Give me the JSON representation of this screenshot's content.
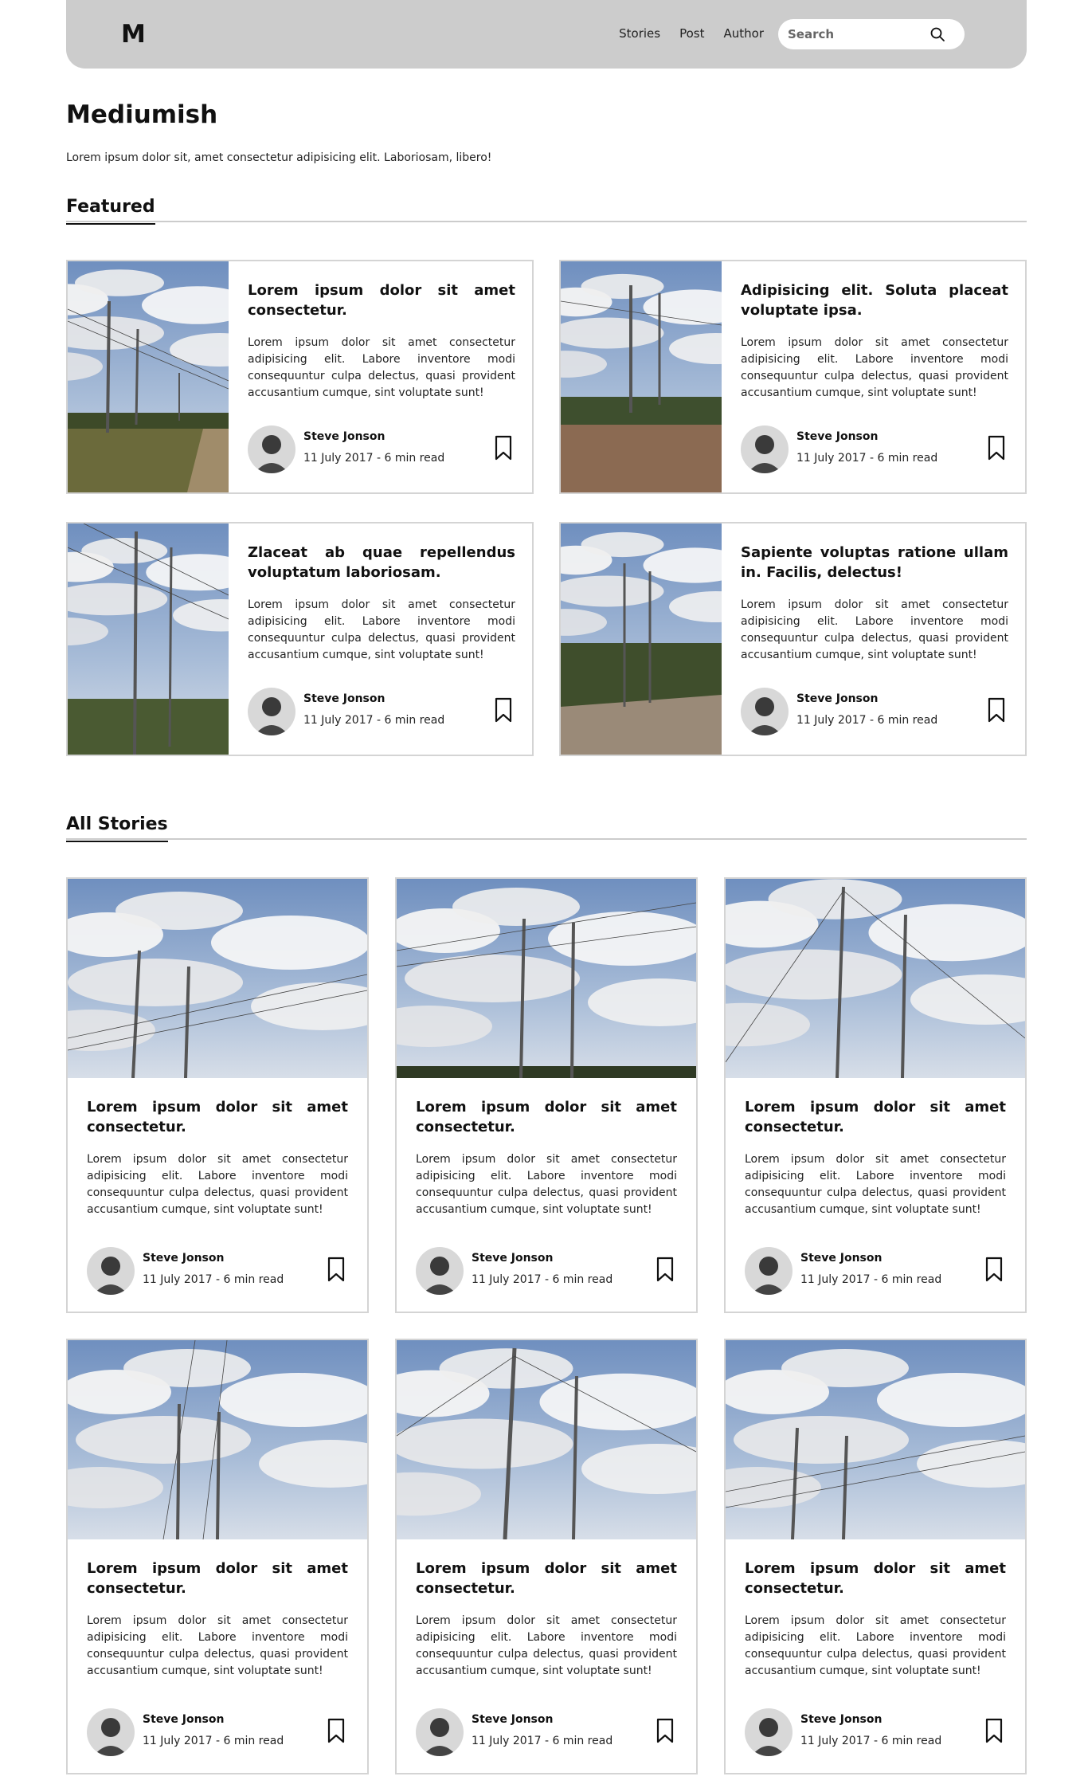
{
  "header": {
    "logo": "M",
    "nav": [
      "Stories",
      "Post",
      "Author"
    ],
    "search_placeholder": "Search"
  },
  "intro": {
    "title": "Mediumish",
    "description": "Lorem ipsum dolor sit, amet consectetur adipisicing elit. Laboriosam, libero!"
  },
  "featured": {
    "heading": "Featured",
    "cards": [
      {
        "title": "Lorem ipsum dolor sit amet consectetur.",
        "excerpt": "Lorem ipsum dolor sit amet consectetur adipisicing elit. Labore inventore modi consequuntur culpa delectus, quasi provident accusantium cumque, sint voluptate sunt!",
        "author": "Steve Jonson",
        "meta": "11 July 2017 - 6 min read"
      },
      {
        "title": "Adipisicing elit. Soluta placeat voluptate ipsa.",
        "excerpt": "Lorem ipsum dolor sit amet consectetur adipisicing elit. Labore inventore modi consequuntur culpa delectus, quasi provident accusantium cumque, sint voluptate sunt!",
        "author": "Steve Jonson",
        "meta": "11 July 2017 - 6 min read"
      },
      {
        "title": "Zlaceat ab quae repellendus voluptatum laboriosam.",
        "excerpt": "Lorem ipsum dolor sit amet consectetur adipisicing elit. Labore inventore modi consequuntur culpa delectus, quasi provident accusantium cumque, sint voluptate sunt!",
        "author": "Steve Jonson",
        "meta": "11 July 2017 - 6 min read"
      },
      {
        "title": "Sapiente voluptas ratione ullam in. Facilis, delectus!",
        "excerpt": "Lorem ipsum dolor sit amet consectetur adipisicing elit. Labore inventore modi consequuntur culpa delectus, quasi provident accusantium cumque, sint voluptate sunt!",
        "author": "Steve Jonson",
        "meta": "11 July 2017 - 6 min read"
      }
    ]
  },
  "stories": {
    "heading": "All Stories",
    "cards": [
      {
        "title": "Lorem ipsum dolor sit amet consectetur.",
        "excerpt": "Lorem ipsum dolor sit amet consectetur adipisicing elit. Labore inventore modi consequuntur culpa delectus, quasi provident accusantium cumque, sint voluptate sunt!",
        "author": "Steve Jonson",
        "meta": "11 July 2017 - 6 min read"
      },
      {
        "title": "Lorem ipsum dolor sit amet consectetur.",
        "excerpt": "Lorem ipsum dolor sit amet consectetur adipisicing elit. Labore inventore modi consequuntur culpa delectus, quasi provident accusantium cumque, sint voluptate sunt!",
        "author": "Steve Jonson",
        "meta": "11 July 2017 - 6 min read"
      },
      {
        "title": "Lorem ipsum dolor sit amet consectetur.",
        "excerpt": "Lorem ipsum dolor sit amet consectetur adipisicing elit. Labore inventore modi consequuntur culpa delectus, quasi provident accusantium cumque, sint voluptate sunt!",
        "author": "Steve Jonson",
        "meta": "11 July 2017 - 6 min read"
      },
      {
        "title": "Lorem ipsum dolor sit amet consectetur.",
        "excerpt": "Lorem ipsum dolor sit amet consectetur adipisicing elit. Labore inventore modi consequuntur culpa delectus, quasi provident accusantium cumque, sint voluptate sunt!",
        "author": "Steve Jonson",
        "meta": "11 July 2017 - 6 min read"
      },
      {
        "title": "Lorem ipsum dolor sit amet consectetur.",
        "excerpt": "Lorem ipsum dolor sit amet consectetur adipisicing elit. Labore inventore modi consequuntur culpa delectus, quasi provident accusantium cumque, sint voluptate sunt!",
        "author": "Steve Jonson",
        "meta": "11 July 2017 - 6 min read"
      },
      {
        "title": "Lorem ipsum dolor sit amet consectetur.",
        "excerpt": "Lorem ipsum dolor sit amet consectetur adipisicing elit. Labore inventore modi consequuntur culpa delectus, quasi provident accusantium cumque, sint voluptate sunt!",
        "author": "Steve Jonson",
        "meta": "11 July 2017 - 6 min read"
      }
    ]
  },
  "icons": {
    "search": "search-icon",
    "bookmark": "bookmark-icon",
    "avatar": "avatar"
  },
  "colors": {
    "header_bg": "#cccccc",
    "border": "#d4d4d4",
    "text": "#111111"
  }
}
